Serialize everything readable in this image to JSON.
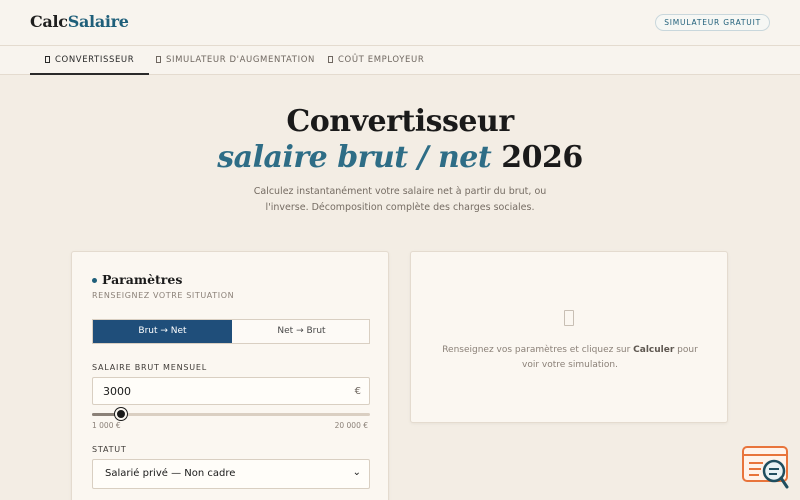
{
  "header": {
    "logo_part1": "Calc",
    "logo_part2": "Salaire",
    "badge": "SIMULATEUR GRATUIT"
  },
  "tabs": [
    {
      "label": "CONVERTISSEUR",
      "active": true
    },
    {
      "label": "SIMULATEUR D'AUGMENTATION",
      "active": false
    },
    {
      "label": "COÛT EMPLOYEUR",
      "active": false
    }
  ],
  "hero": {
    "title_line1": "Convertisseur",
    "title_accent": "salaire brut / net",
    "title_year": "2026",
    "subtitle_line1": "Calculez instantanément votre salaire net à partir du brut, ou",
    "subtitle_line2": "l'inverse. Décomposition complète des charges sociales."
  },
  "params": {
    "title": "Paramètres",
    "subtitle": "RENSEIGNEZ VOTRE SITUATION",
    "mode_options": [
      "Brut → Net",
      "Net → Brut"
    ],
    "mode_selected": 0,
    "salary_label": "SALAIRE BRUT MENSUEL",
    "salary_value": "3000",
    "currency": "€",
    "slider": {
      "min": 1000,
      "max": 20000,
      "value": 3000,
      "min_label": "1 000 €",
      "max_label": "20 000 €"
    },
    "status_label": "STATUT",
    "status_value": "Salarié privé — Non cadre",
    "chevron": "⌄"
  },
  "result": {
    "empty_text_before": "Renseignez vos paramètres et cliquez sur ",
    "empty_text_bold": "Calculer",
    "empty_text_after": " pour voir votre simulation."
  },
  "icons": {
    "tab_icon": "document-icon",
    "result_icon": "document-icon",
    "widget_icon": "chat-search-icon"
  },
  "colors": {
    "accent": "#1f5f7a",
    "primary_button": "#1f4e7a",
    "widget": "#e8743b"
  }
}
